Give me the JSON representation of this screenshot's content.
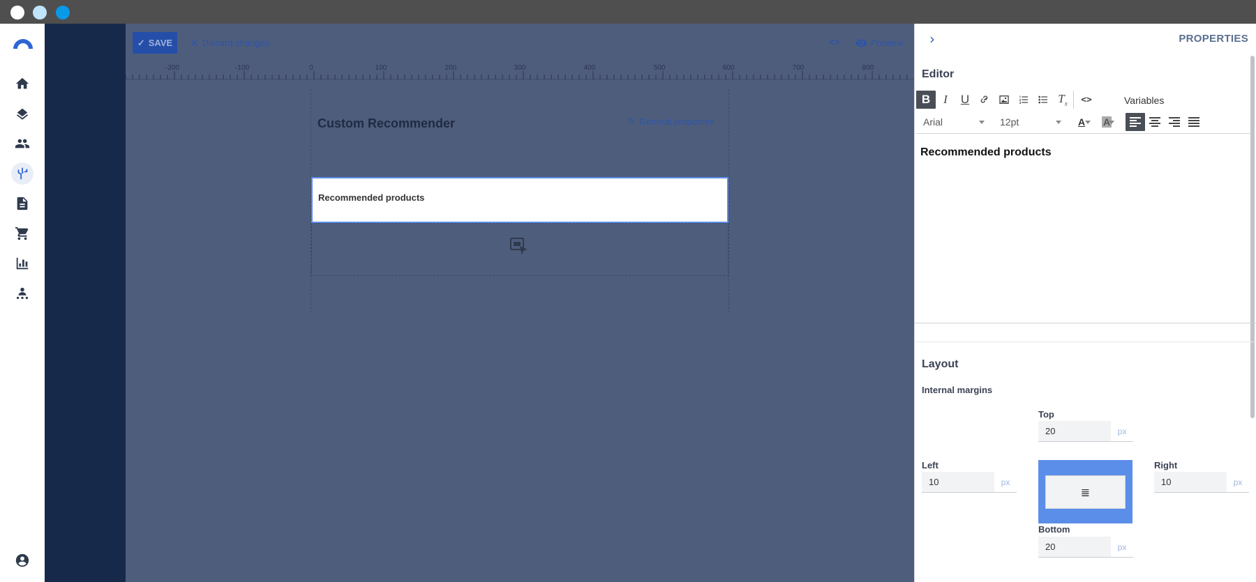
{
  "window": {
    "controls": [
      "close",
      "minimize",
      "maximize"
    ]
  },
  "rail": {
    "items": [
      {
        "icon": "home-icon",
        "active": false
      },
      {
        "icon": "layers-icon",
        "active": false
      },
      {
        "icon": "people-icon",
        "active": false
      },
      {
        "icon": "flow-icon",
        "active": true
      },
      {
        "icon": "document-icon",
        "active": false
      },
      {
        "icon": "cart-icon",
        "active": false
      },
      {
        "icon": "chart-icon",
        "active": false
      },
      {
        "icon": "segment-icon",
        "active": false
      }
    ],
    "account_icon": "account-icon"
  },
  "toolbar": {
    "save_label": "SAVE",
    "discard_label": "Discard changes",
    "code_label": "<>",
    "preview_label": "Preview"
  },
  "ruler": {
    "labels": [
      "-200",
      "-100",
      "0",
      "100",
      "200",
      "300",
      "400",
      "500",
      "600",
      "700",
      "800"
    ]
  },
  "canvas": {
    "title": "Custom Recommender",
    "general_properties_label": "General properties",
    "text_block": "Recommended products"
  },
  "panel": {
    "title": "PROPERTIES",
    "editor_title": "Editor",
    "variables_label": "Variables",
    "font_family": "Arial",
    "font_size": "12pt",
    "editor_content": "Recommended products",
    "layout_title": "Layout",
    "internal_margins_label": "Internal margins",
    "margins": {
      "top_label": "Top",
      "top_value": "20",
      "left_label": "Left",
      "left_value": "10",
      "right_label": "Right",
      "right_value": "10",
      "bottom_label": "Bottom",
      "bottom_value": "20",
      "unit": "px"
    }
  },
  "colors": {
    "accent": "#2f66d6",
    "nav_dark": "#17294a",
    "selection": "#5b8ee8"
  }
}
